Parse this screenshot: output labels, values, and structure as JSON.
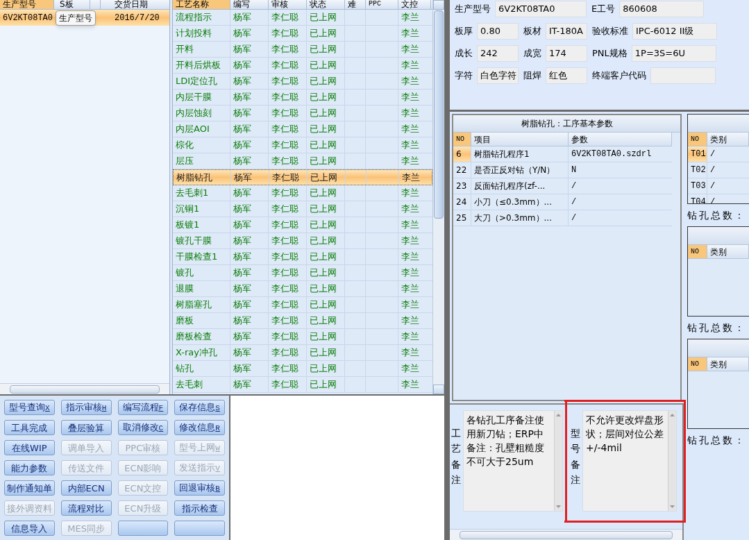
{
  "model_grid": {
    "columns": [
      "生产型号",
      "S板",
      "交货日期"
    ],
    "rows": [
      {
        "model": "6V2KT08TA0",
        "date": "2016/7/20",
        "selected": true
      }
    ],
    "tooltip": "生产型号"
  },
  "process_table": {
    "columns": [
      "工艺名称",
      "编写",
      "审核",
      "状态",
      "难",
      "PPC",
      "文控"
    ],
    "rows": [
      {
        "name": "流程指示",
        "writer": "杨军",
        "reviewer": "李仁聪",
        "status": "已上网",
        "control": "李兰",
        "selected": false
      },
      {
        "name": "计划投料",
        "writer": "杨军",
        "reviewer": "李仁聪",
        "status": "已上网",
        "control": "李兰",
        "selected": false
      },
      {
        "name": "开料",
        "writer": "杨军",
        "reviewer": "李仁聪",
        "status": "已上网",
        "control": "李兰",
        "selected": false
      },
      {
        "name": "开料后烘板",
        "writer": "杨军",
        "reviewer": "李仁聪",
        "status": "已上网",
        "control": "李兰",
        "selected": false
      },
      {
        "name": "LDI定位孔",
        "writer": "杨军",
        "reviewer": "李仁聪",
        "status": "已上网",
        "control": "李兰",
        "selected": false
      },
      {
        "name": "内层干膜",
        "writer": "杨军",
        "reviewer": "李仁聪",
        "status": "已上网",
        "control": "李兰",
        "selected": false
      },
      {
        "name": "内层蚀刻",
        "writer": "杨军",
        "reviewer": "李仁聪",
        "status": "已上网",
        "control": "李兰",
        "selected": false
      },
      {
        "name": "内层AOI",
        "writer": "杨军",
        "reviewer": "李仁聪",
        "status": "已上网",
        "control": "李兰",
        "selected": false
      },
      {
        "name": "棕化",
        "writer": "杨军",
        "reviewer": "李仁聪",
        "status": "已上网",
        "control": "李兰",
        "selected": false
      },
      {
        "name": "层压",
        "writer": "杨军",
        "reviewer": "李仁聪",
        "status": "已上网",
        "control": "李兰",
        "selected": false
      },
      {
        "name": "树脂钻孔",
        "writer": "杨军",
        "reviewer": "李仁聪",
        "status": "已上网",
        "control": "李兰",
        "selected": true
      },
      {
        "name": "去毛刺1",
        "writer": "杨军",
        "reviewer": "李仁聪",
        "status": "已上网",
        "control": "李兰",
        "selected": false
      },
      {
        "name": "沉铜1",
        "writer": "杨军",
        "reviewer": "李仁聪",
        "status": "已上网",
        "control": "李兰",
        "selected": false
      },
      {
        "name": "板镀1",
        "writer": "杨军",
        "reviewer": "李仁聪",
        "status": "已上网",
        "control": "李兰",
        "selected": false
      },
      {
        "name": "镀孔干膜",
        "writer": "杨军",
        "reviewer": "李仁聪",
        "status": "已上网",
        "control": "李兰",
        "selected": false
      },
      {
        "name": "干膜检查1",
        "writer": "杨军",
        "reviewer": "李仁聪",
        "status": "已上网",
        "control": "李兰",
        "selected": false
      },
      {
        "name": "镀孔",
        "writer": "杨军",
        "reviewer": "李仁聪",
        "status": "已上网",
        "control": "李兰",
        "selected": false
      },
      {
        "name": "退膜",
        "writer": "杨军",
        "reviewer": "李仁聪",
        "status": "已上网",
        "control": "李兰",
        "selected": false
      },
      {
        "name": "树脂塞孔",
        "writer": "杨军",
        "reviewer": "李仁聪",
        "status": "已上网",
        "control": "李兰",
        "selected": false
      },
      {
        "name": "磨板",
        "writer": "杨军",
        "reviewer": "李仁聪",
        "status": "已上网",
        "control": "李兰",
        "selected": false
      },
      {
        "name": "磨板检查",
        "writer": "杨军",
        "reviewer": "李仁聪",
        "status": "已上网",
        "control": "李兰",
        "selected": false
      },
      {
        "name": "X-ray冲孔",
        "writer": "杨军",
        "reviewer": "李仁聪",
        "status": "已上网",
        "control": "李兰",
        "selected": false
      },
      {
        "name": "钻孔",
        "writer": "杨军",
        "reviewer": "李仁聪",
        "status": "已上网",
        "control": "李兰",
        "selected": false
      },
      {
        "name": "去毛刺",
        "writer": "杨军",
        "reviewer": "李仁聪",
        "status": "已上网",
        "control": "李兰",
        "selected": false
      }
    ]
  },
  "buttons": [
    {
      "label": "型号查询",
      "key": "X",
      "disabled": false
    },
    {
      "label": "指示审核",
      "key": "H",
      "disabled": false
    },
    {
      "label": "编写流程",
      "key": "F",
      "disabled": false
    },
    {
      "label": "保存信息",
      "key": "S",
      "disabled": false
    },
    {
      "label": "工具完成",
      "disabled": false
    },
    {
      "label": "叠层验算",
      "disabled": false
    },
    {
      "label": "取消修改",
      "key": "C",
      "disabled": false
    },
    {
      "label": "修改信息",
      "key": "R",
      "disabled": false
    },
    {
      "label": "在线WIP",
      "disabled": false
    },
    {
      "label": "调单导入",
      "disabled": true
    },
    {
      "label": "PPC审核",
      "disabled": true
    },
    {
      "label": "型号上网",
      "key": "W",
      "disabled": true
    },
    {
      "label": "能力参数",
      "disabled": false
    },
    {
      "label": "传送文件",
      "disabled": true
    },
    {
      "label": "ECN影响",
      "disabled": true
    },
    {
      "label": "发送指示",
      "key": "V",
      "disabled": true
    },
    {
      "label": "制作通知单",
      "disabled": false
    },
    {
      "label": "内部ECN",
      "disabled": false
    },
    {
      "label": "ECN文控",
      "disabled": true
    },
    {
      "label": "回退审核",
      "key": "B",
      "disabled": false
    },
    {
      "label": "接外调资料",
      "disabled": true
    },
    {
      "label": "流程对比",
      "disabled": false
    },
    {
      "label": "ECN升级",
      "disabled": true
    },
    {
      "label": "指示检查",
      "disabled": false
    },
    {
      "label": "信息导入",
      "disabled": false
    },
    {
      "label": "MES同步",
      "disabled": true
    },
    {
      "disabled": false
    },
    {
      "disabled": false
    }
  ],
  "info_form": [
    [
      {
        "label": "生产型号",
        "value": "6V2KT08TA0"
      },
      {
        "label": "E工号",
        "value": "860608"
      }
    ],
    [
      {
        "label": "板厚",
        "value": "0.80"
      },
      {
        "label": "板材",
        "value": "IT-180A"
      },
      {
        "label": "验收标准",
        "value": "IPC-6012 II级"
      }
    ],
    [
      {
        "label": "成长",
        "value": "242"
      },
      {
        "label": "成宽",
        "value": "174"
      },
      {
        "label": "PNL规格",
        "value": "1P=3S=6U"
      }
    ],
    [
      {
        "label": "字符",
        "value": "白色字符"
      },
      {
        "label": "阻焊",
        "value": "红色"
      },
      {
        "label": "终端客户代码"
      }
    ]
  ],
  "params_table": {
    "title": "树脂钻孔：工序基本参数",
    "columns": [
      "NO",
      "项目",
      "参数"
    ],
    "rows": [
      {
        "no": "6",
        "item": "树脂钻孔程序1",
        "value": "6V2KT08TA0.szdrl",
        "selected": true
      },
      {
        "no": "22",
        "item": "是否正反对钻（Y/N）",
        "value": "N",
        "selected": false
      },
      {
        "no": "23",
        "item": "反面钻孔程序(zf-...",
        "value": "/",
        "selected": false
      },
      {
        "no": "24",
        "item": "小刀（≤0.3mm）...",
        "value": "/",
        "selected": false
      },
      {
        "no": "25",
        "item": "大刀（>0.3mm）...",
        "value": "/",
        "selected": false
      }
    ]
  },
  "drill_tables": [
    {
      "columns": [
        "NO",
        "类别"
      ],
      "rows": [
        {
          "no": "T01",
          "type": "/",
          "selected": true
        },
        {
          "no": "T02",
          "type": "/",
          "selected": false
        },
        {
          "no": "T03",
          "type": "/",
          "selected": false
        },
        {
          "no": "T04",
          "type": "/",
          "selected": false
        }
      ],
      "total_label": "钻孔总数："
    },
    {
      "columns": [
        "NO",
        "类别"
      ],
      "total_label": "钻孔总数："
    },
    {
      "columns": [
        "NO",
        "类别"
      ],
      "total_label": "钻孔总数："
    }
  ],
  "notes": [
    {
      "label": "工艺备注",
      "text": "各钻孔工序备注使用新刀钻；ERP中备注：孔壁粗糙度不可大于25um"
    },
    {
      "label": "型号备注",
      "text": "不允许更改焊盘形状；层间对位公差+/-4mil"
    }
  ]
}
